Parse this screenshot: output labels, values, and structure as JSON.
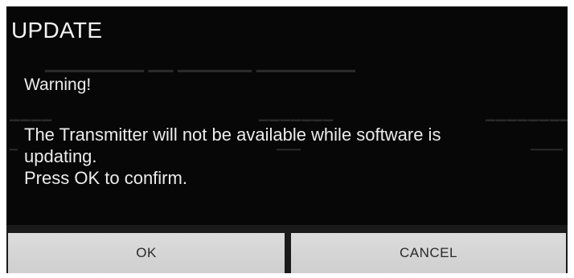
{
  "dialog": {
    "title": "UPDATE",
    "warning": "Warning!",
    "message_lines": [
      "The Transmitter will not be available while software is",
      "updating.",
      "Press OK to confirm."
    ],
    "buttons": {
      "ok_label": "OK",
      "cancel_label": "CANCEL"
    }
  },
  "colors": {
    "dialog_background": "#070707",
    "text": "#ececec",
    "button_background": "#d6d6d6",
    "button_text": "#2a2a2a"
  }
}
